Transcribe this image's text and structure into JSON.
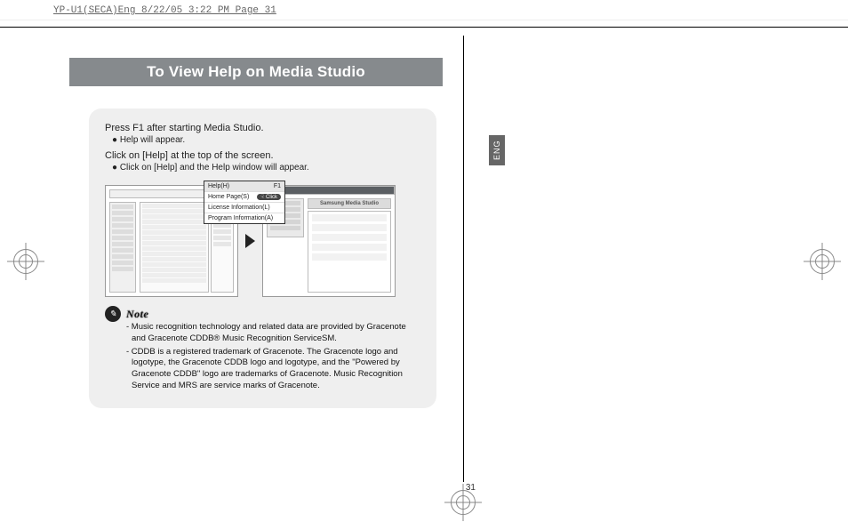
{
  "running_head": "YP-U1(SECA)Eng  8/22/05 3:22 PM  Page 31",
  "title": "To View Help on Media Studio",
  "body": {
    "line1": "Press F1 after starting Media Studio.",
    "bullet1": "● Help will appear.",
    "line2": "Click on [Help] at the top of the screen.",
    "bullet2": "● Click on [Help] and the Help window will appear."
  },
  "menu": {
    "item1_label": "Help(H)",
    "item1_key": "F1",
    "item2_label": "Home Page(S)",
    "click_label": "Click",
    "item3_label": "License Information(L)",
    "item4_label": "Program Information(A)"
  },
  "help_window_title": "Samsung Media Studio",
  "note": {
    "label": "Note",
    "p1": "- Music recognition technology and related data are provided by Gracenote and Gracenote CDDB® Music Recognition ServiceSM.",
    "p2": "- CDDB is a registered trademark of Gracenote. The Gracenote logo and logotype, the Gracenote CDDB logo and logotype, and the \"Powered by Gracenote CDDB\" logo are trademarks of Gracenote. Music Recognition Service and MRS are service marks of Gracenote."
  },
  "page_number": "31",
  "lang_tab": "ENG"
}
